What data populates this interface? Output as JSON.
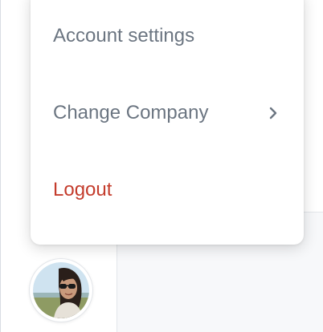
{
  "menu": {
    "items": [
      {
        "label": "Account settings"
      },
      {
        "label": "Change Company",
        "icon": "chevron-right-icon"
      },
      {
        "label": "Logout"
      }
    ]
  },
  "user": {
    "avatar": "user-avatar-photo"
  },
  "colors": {
    "menu_text": "#6b7581",
    "logout_text": "#c43c2c",
    "menu_background": "#ffffff",
    "main_background": "#f7f8fa"
  }
}
